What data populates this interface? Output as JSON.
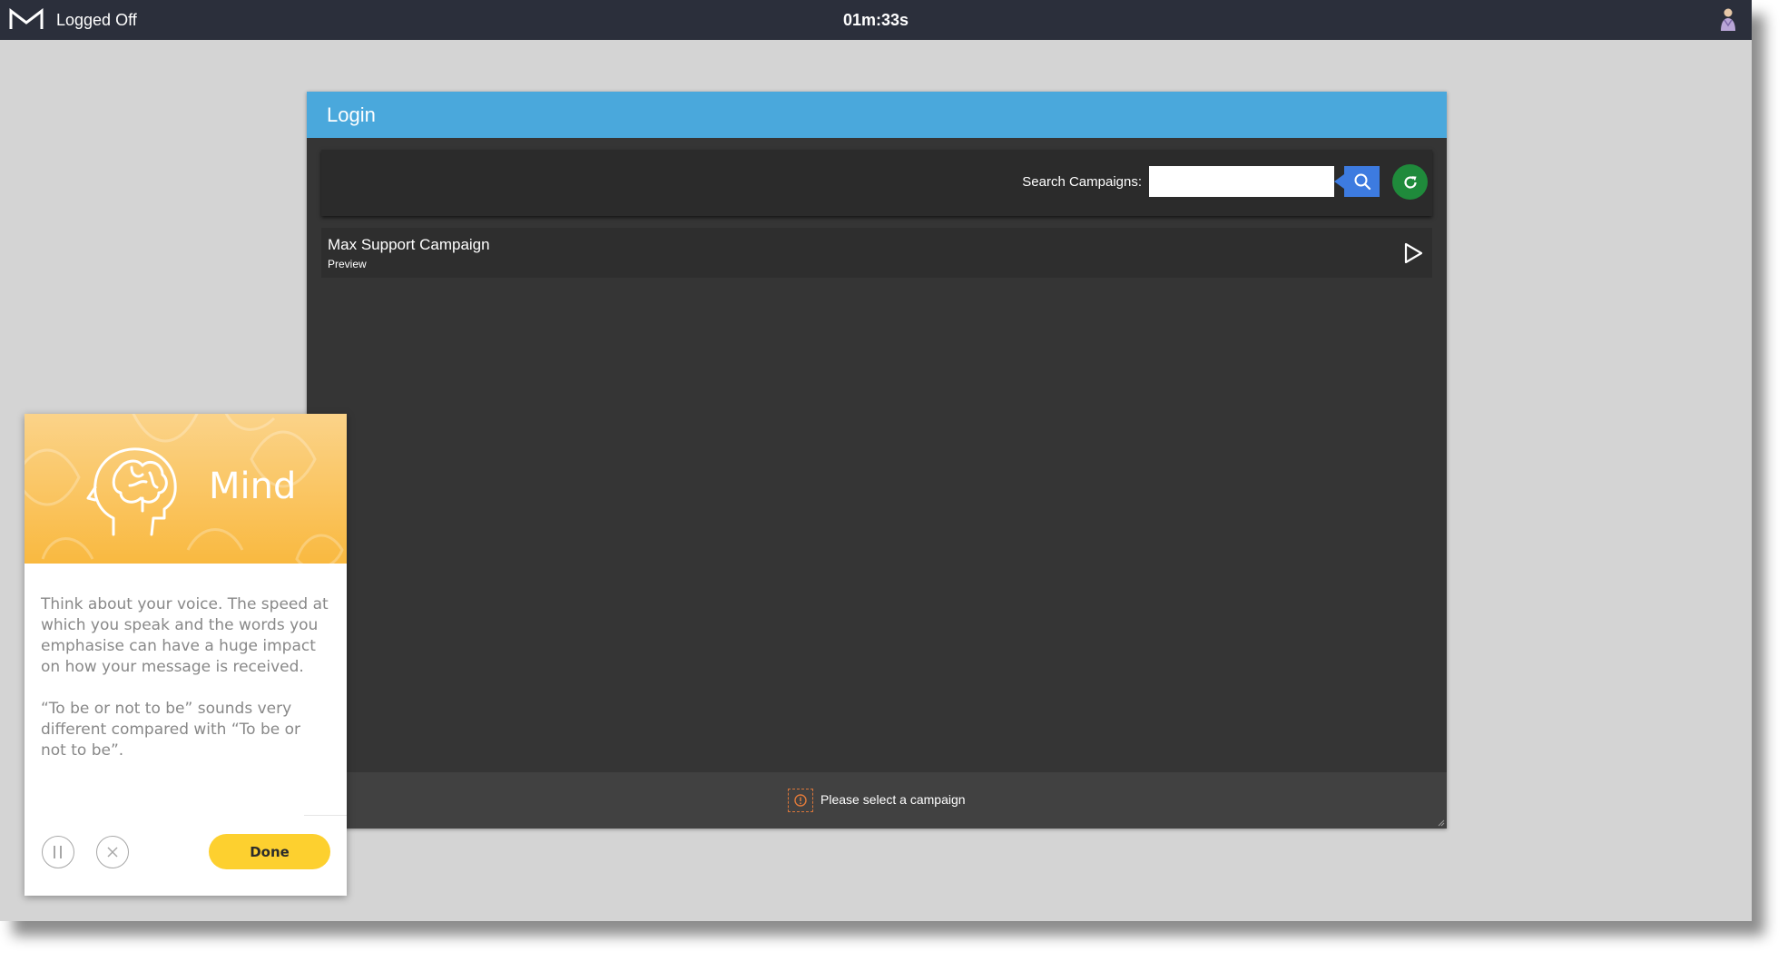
{
  "topbar": {
    "logo_icon": "m-logo-icon",
    "status": "Logged Off",
    "timer": "01m:33s",
    "user_icon": "agent-avatar-icon"
  },
  "login": {
    "title": "Login",
    "search": {
      "label": "Search Campaigns:",
      "value": "",
      "placeholder": "",
      "search_icon": "search-icon",
      "refresh_icon": "refresh-icon"
    },
    "campaigns": [
      {
        "name": "Max Support Campaign",
        "mode": "Preview",
        "action_icon": "play-icon"
      }
    ],
    "footer": {
      "icon": "info-icon",
      "message": "Please select a campaign"
    }
  },
  "mind_card": {
    "title": "Mind",
    "icon": "brain-head-icon",
    "paragraphs": [
      "Think about your voice. The speed at which you speak and the words you emphasise can have a huge impact on how your message is received.",
      "“To be or not to be” sounds very different compared with “To be or not to be”."
    ],
    "pause_icon": "pause-icon",
    "close_icon": "close-icon",
    "done_label": "Done"
  },
  "colors": {
    "topbar": "#2b2f3b",
    "desktop": "#d4d4d4",
    "panel_header": "#4aa8dc",
    "panel_body": "#353535",
    "search_button": "#3d7be0",
    "refresh_button": "#1f8a3b",
    "card_header": "#f9b940",
    "done_button": "#fdd02f"
  }
}
